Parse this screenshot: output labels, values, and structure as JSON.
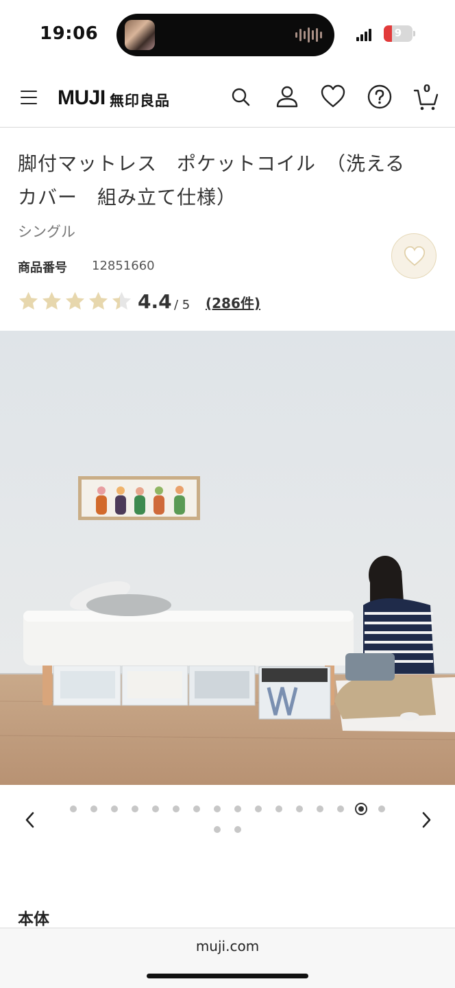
{
  "status_bar": {
    "time": "19:06",
    "battery": "9",
    "colors": {
      "battery_low": "#e23a3a"
    }
  },
  "header": {
    "logo_latin": "MUJI",
    "logo_kanji": "無印良品",
    "cart_count": "0",
    "icons": [
      "menu-icon",
      "search-icon",
      "account-icon",
      "heart-icon",
      "help-icon",
      "cart-icon"
    ]
  },
  "product": {
    "title_line1": "脚付マットレス　ポケットコイル　（洗える",
    "title_line2": "カバー　組み立て仕様）",
    "size": "シングル",
    "product_number_label": "商品番号",
    "product_number": "12851660",
    "rating": "4.4",
    "rating_max": "/ 5",
    "rating_value": 4.4,
    "review_count": "(286件)",
    "colors": {
      "star": "#e7d7ad",
      "star_empty": "#e6e6e6",
      "favorite_bg": "#f7f1e5"
    }
  },
  "carousel": {
    "total_images": 18,
    "active_index": 14
  },
  "section": {
    "heading": "本体"
  },
  "browser": {
    "url": "muji.com"
  }
}
